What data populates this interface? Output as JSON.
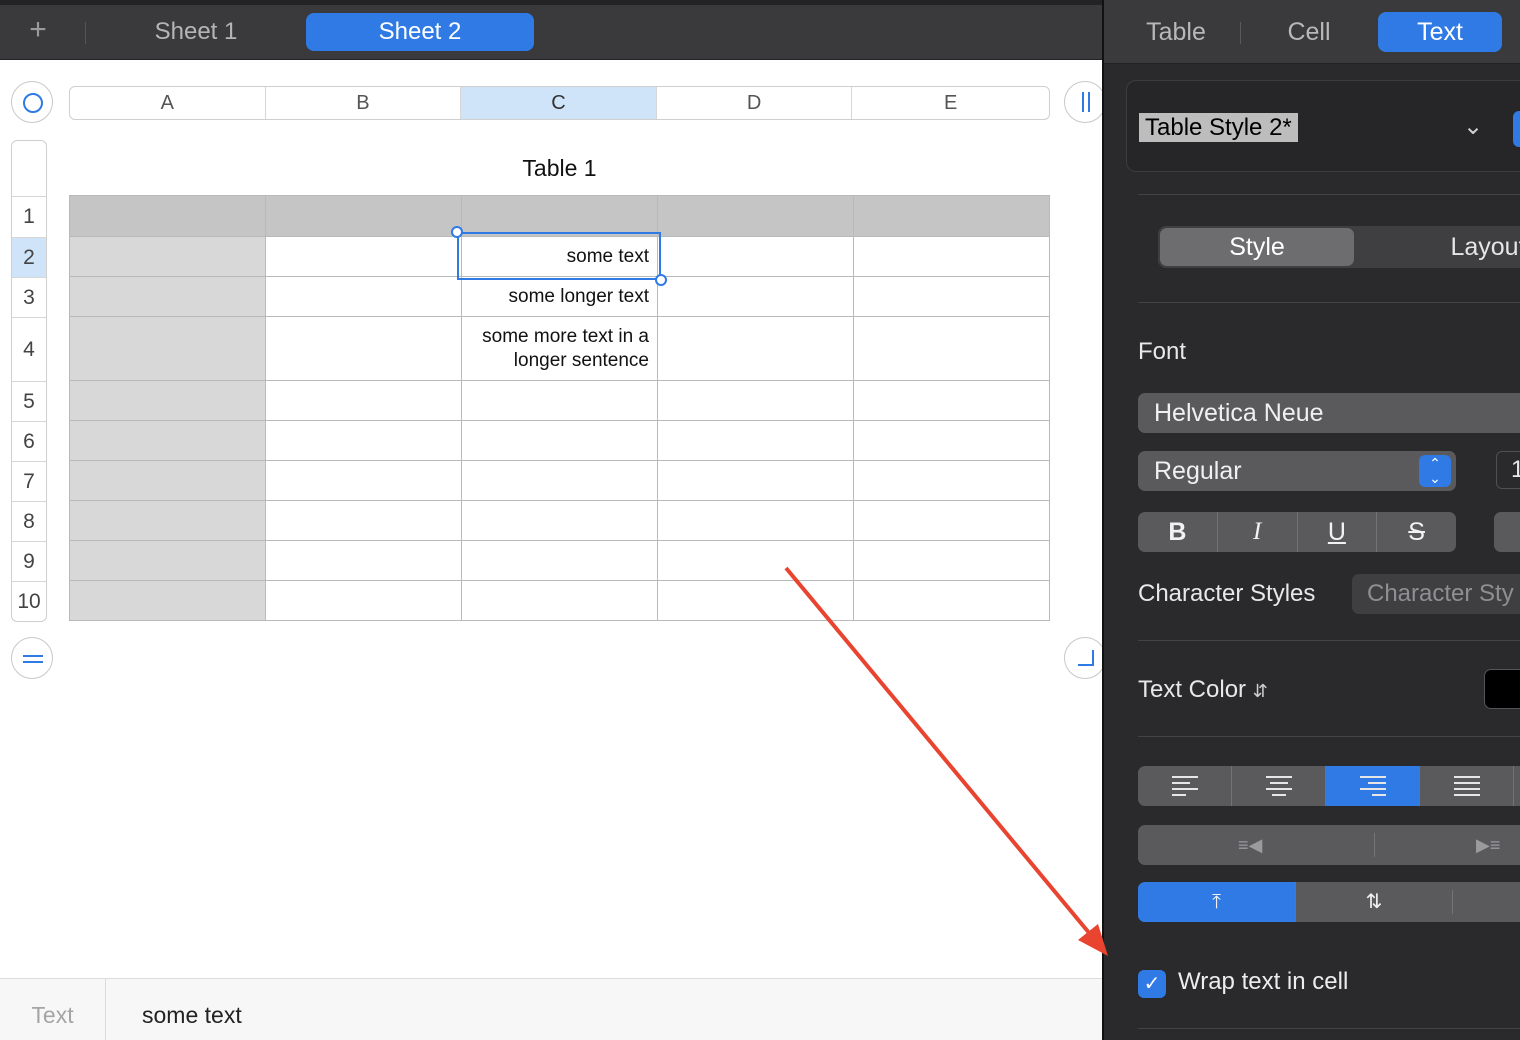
{
  "tabbar": {
    "add_icon": "+",
    "sheets": [
      {
        "label": "Sheet 1"
      },
      {
        "label": "Sheet 2"
      }
    ]
  },
  "table": {
    "title": "Table 1",
    "columns": [
      "A",
      "B",
      "C",
      "D",
      "E"
    ],
    "selected_column": "C",
    "rows": [
      "1",
      "2",
      "3",
      "4",
      "5",
      "6",
      "7",
      "8",
      "9",
      "10"
    ],
    "selected_row": "2",
    "cells": {
      "C2": "some text",
      "C3": "some longer text",
      "C4": "some more text in a longer sentence"
    }
  },
  "formula_bar": {
    "label": "Text",
    "value": "some text"
  },
  "inspector": {
    "tabs": [
      {
        "label": "Table"
      },
      {
        "label": "Cell"
      },
      {
        "label": "Text"
      }
    ],
    "paragraph_style": "Table Style 2*",
    "segment": {
      "style": "Style",
      "layout": "Layout"
    },
    "font_label": "Font",
    "font_family": "Helvetica Neue",
    "font_weight": "Regular",
    "font_size_partial": "1",
    "format_buttons": {
      "bold": "B",
      "italic": "I",
      "underline": "U",
      "strike": "S"
    },
    "character_styles_label": "Character Styles",
    "character_styles_placeholder": "Character Sty",
    "text_color_label": "Text Color",
    "text_color": "#000000",
    "selected_alignment": "right",
    "vertical_alignment": "top",
    "wrap_label": "Wrap text in cell",
    "wrap_checked": true
  },
  "colors": {
    "accent": "#2f7ae5",
    "arrow": "#e8442f"
  }
}
